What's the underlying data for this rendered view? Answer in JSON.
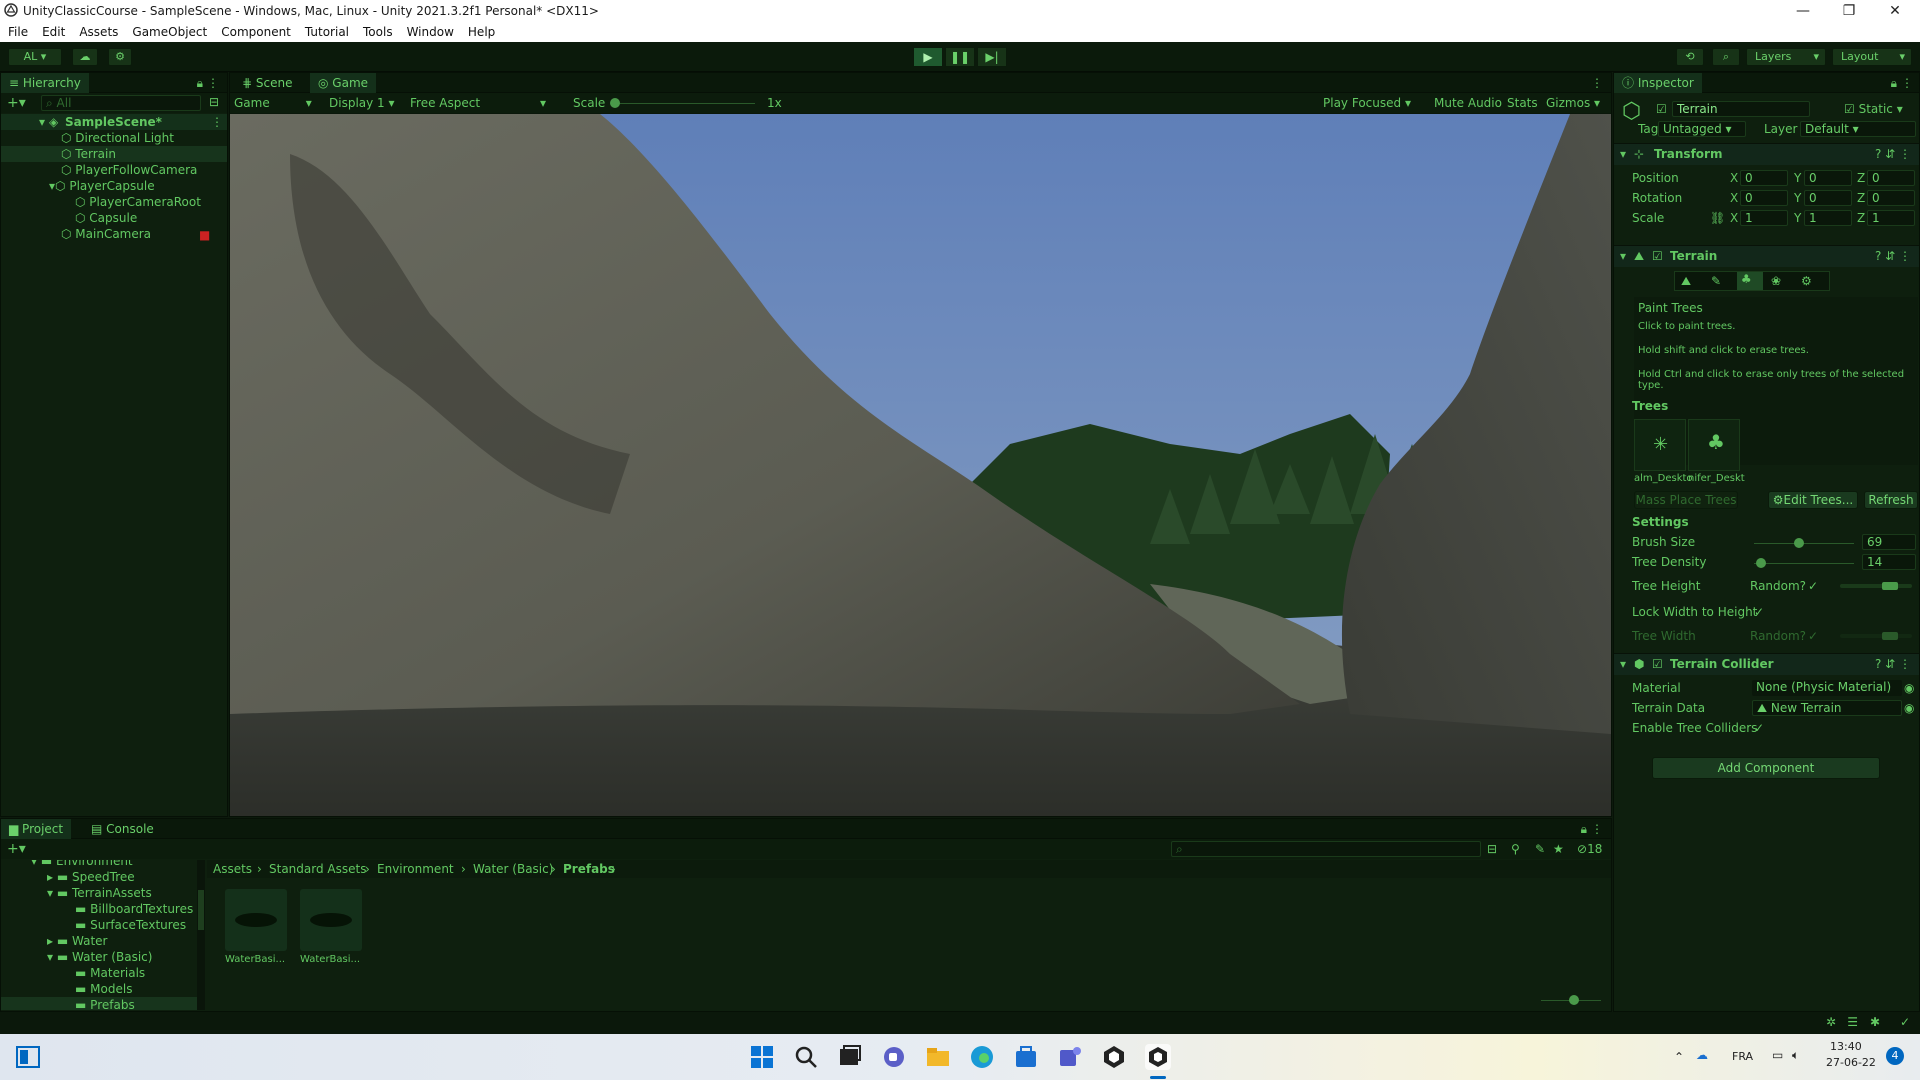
{
  "window": {
    "title": "UnityClassicCourse - SampleScene - Windows, Mac, Linux - Unity 2021.3.2f1 Personal* <DX11>",
    "minimize": "—",
    "maximize": "❐",
    "close": "✕"
  },
  "menu": [
    "File",
    "Edit",
    "Assets",
    "GameObject",
    "Component",
    "Tutorial",
    "Tools",
    "Window",
    "Help"
  ],
  "toolbar": {
    "account": "AL",
    "layers": "Layers",
    "layout": "Layout"
  },
  "hierarchy": {
    "tab": "Hierarchy",
    "search_placeholder": "All",
    "scene": "SampleScene*",
    "items": [
      {
        "label": "Directional Light",
        "depth": 1
      },
      {
        "label": "Terrain",
        "depth": 1
      },
      {
        "label": "PlayerFollowCamera",
        "depth": 1
      },
      {
        "label": "PlayerCapsule",
        "depth": 1
      },
      {
        "label": "PlayerCameraRoot",
        "depth": 2
      },
      {
        "label": "Capsule",
        "depth": 2
      },
      {
        "label": "MainCamera",
        "depth": 1
      }
    ]
  },
  "game": {
    "tabs": [
      "Scene",
      "Game"
    ],
    "mode": "Game",
    "display": "Display 1",
    "aspect": "Free Aspect",
    "scale_label": "Scale",
    "scale_value": "1x",
    "play_focused": "Play Focused",
    "mute": "Mute Audio",
    "stats": "Stats",
    "gizmos": "Gizmos"
  },
  "inspector": {
    "tab": "Inspector",
    "object_name": "Terrain",
    "static": "Static",
    "tag_label": "Tag",
    "tag_value": "Untagged",
    "layer_label": "Layer",
    "layer_value": "Default",
    "transform": {
      "title": "Transform",
      "rows": [
        {
          "label": "Position",
          "x": "0",
          "y": "0",
          "z": "0"
        },
        {
          "label": "Rotation",
          "x": "0",
          "y": "0",
          "z": "0"
        },
        {
          "label": "Scale",
          "x": "1",
          "y": "1",
          "z": "1"
        }
      ]
    },
    "terrain": {
      "title": "Terrain",
      "paint_title": "Paint Trees",
      "help1": "Click to paint trees.",
      "help2": "Hold shift and click to erase trees.",
      "help3": "Hold Ctrl and click to erase only trees of the selected type.",
      "trees_label": "Trees",
      "tree1": "alm_Deskto",
      "tree2": "nifer_Deskt",
      "mass_place": "Mass Place Trees",
      "edit_trees": "Edit Trees...",
      "refresh": "Refresh",
      "settings_label": "Settings",
      "brush_size_label": "Brush Size",
      "brush_size_value": "69",
      "tree_density_label": "Tree Density",
      "tree_density_value": "14",
      "tree_height_label": "Tree Height",
      "random_label": "Random?",
      "lock_width_label": "Lock Width to Height",
      "tree_width_label": "Tree Width",
      "random_label2": "Random?"
    },
    "collider": {
      "title": "Terrain Collider",
      "material_label": "Material",
      "material_value": "None (Physic Material)",
      "data_label": "Terrain Data",
      "data_value": "New Terrain",
      "enable_label": "Enable Tree Colliders"
    },
    "add_component": "Add Component"
  },
  "project": {
    "tabs": [
      "Project",
      "Console"
    ],
    "tree": [
      {
        "label": "Environment",
        "depth": 1
      },
      {
        "label": "SpeedTree",
        "depth": 2
      },
      {
        "label": "TerrainAssets",
        "depth": 2
      },
      {
        "label": "BillboardTextures",
        "depth": 3
      },
      {
        "label": "SurfaceTextures",
        "depth": 3
      },
      {
        "label": "Water",
        "depth": 2
      },
      {
        "label": "Water (Basic)",
        "depth": 2
      },
      {
        "label": "Materials",
        "depth": 3
      },
      {
        "label": "Models",
        "depth": 3
      },
      {
        "label": "Prefabs",
        "depth": 3
      }
    ],
    "breadcrumb": [
      "Assets",
      "Standard Assets",
      "Environment",
      "Water (Basic)",
      "Prefabs"
    ],
    "assets": [
      "WaterBasi...",
      "WaterBasi..."
    ],
    "hidden_count": "18"
  },
  "taskbar": {
    "lang": "FRA",
    "time": "13:40",
    "date": "27-06-22",
    "notif": "4"
  },
  "colors": {
    "accent": "#62c862",
    "panel": "#0e1f0e",
    "sky": "#6f8fbf"
  }
}
